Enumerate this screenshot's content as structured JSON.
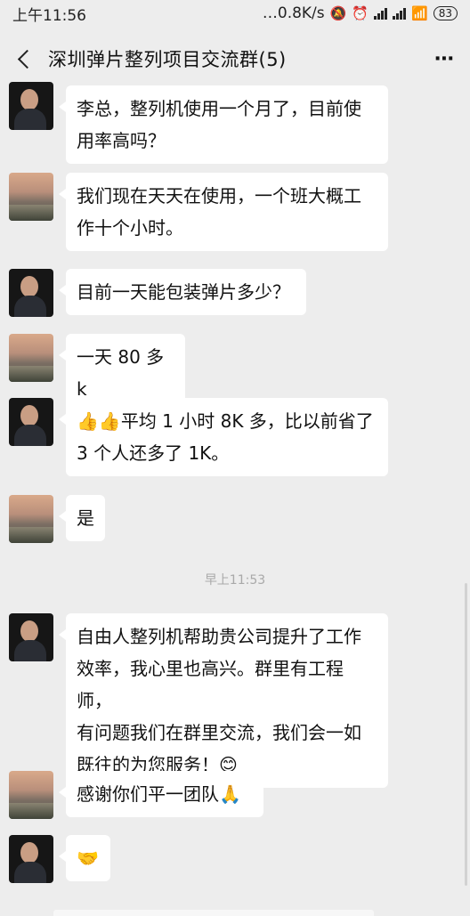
{
  "status_bar": {
    "time": "上午11:56",
    "network_speed": "…0.8K/s",
    "battery": "83"
  },
  "header": {
    "title": "深圳弹片整列项目交流群(5)",
    "more": "⋯"
  },
  "time_separator": "早上11:53",
  "messages": [
    {
      "sender": "man",
      "text_lines": [
        "李总，整列机使用一个月了，目前使",
        "用率高吗？"
      ]
    },
    {
      "sender": "landscape",
      "text_lines": [
        "我们现在天天在使用，一个班大概工",
        "作十个小时。"
      ]
    },
    {
      "sender": "man",
      "text_lines": [
        "目前一天能包装弹片多少？"
      ]
    },
    {
      "sender": "landscape",
      "text_lines": [
        "一天 80 多 k"
      ]
    },
    {
      "sender": "man",
      "emoji_prefix": "👍👍",
      "text_lines": [
        "平均 1 小时 8K 多，比以前省了",
        "3 个人还多了 1K。"
      ]
    },
    {
      "sender": "landscape",
      "text_lines": [
        "是"
      ]
    },
    {
      "sender": "man",
      "text_lines": [
        "自由人整列机帮助贵公司提升了工作",
        "效率，我心里也高兴。群里有工程师，",
        "有问题我们在群里交流，我们会一如",
        "既往的为您服务！"
      ],
      "emoji_suffix": "😊"
    },
    {
      "sender": "landscape",
      "text_lines": [
        "感谢你们平一团队"
      ],
      "emoji_suffix": "🙏"
    },
    {
      "sender": "man",
      "emoji_prefix": "🤝",
      "text_lines": []
    }
  ]
}
